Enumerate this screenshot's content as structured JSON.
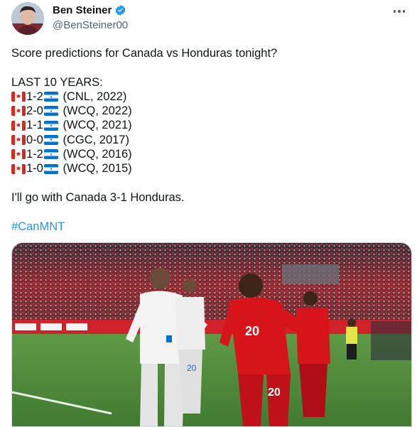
{
  "author": {
    "name": "Ben Steiner",
    "handle": "@BenSteiner00",
    "verified": true,
    "avatar": "profile photo"
  },
  "menu": {
    "icon": "more-icon"
  },
  "tweet": {
    "intro": "Score predictions for Canada vs Honduras tonight?",
    "history_heading": "LAST 10 YEARS:",
    "results": [
      {
        "score": "1-2",
        "detail": " (CNL, 2022)"
      },
      {
        "score": "2-0",
        "detail": " (WCQ, 2022)"
      },
      {
        "score": "1-1",
        "detail": " (WCQ, 2021)"
      },
      {
        "score": "0-0",
        "detail": " (CGC, 2017)"
      },
      {
        "score": "1-2",
        "detail": " (WCQ, 2016)"
      },
      {
        "score": "1-0",
        "detail": " (WCQ, 2015)"
      }
    ],
    "prediction": "I'll go with Canada 3-1 Honduras.",
    "hashtag": "#CanMNT"
  },
  "media": {
    "kind": "photo",
    "colors": {
      "canada": "#d7141a",
      "honduras": "#f2f2f2",
      "pitch": "#4f8a3a"
    },
    "jersey_numbers": [
      "20",
      "20"
    ]
  },
  "colors": {
    "accent": "#1d9bf0",
    "secondary_text": "#536471",
    "verified": "#1d9bf0"
  }
}
